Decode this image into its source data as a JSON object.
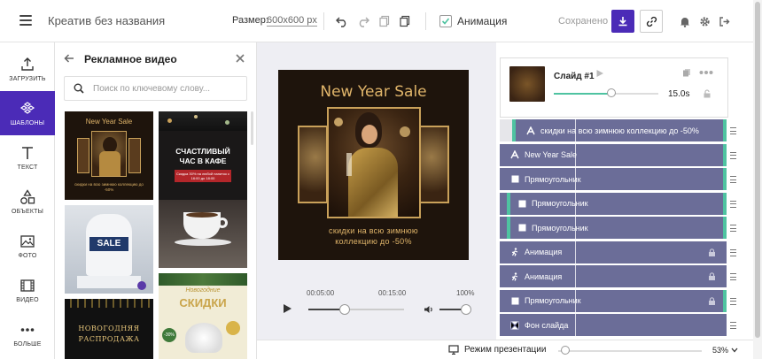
{
  "topbar": {
    "doc_title": "Креатив без названия",
    "size_label": "Размер:",
    "size_value": "600x600 px",
    "animation_label": "Анимация",
    "saved_label": "Сохранено"
  },
  "rail": {
    "items": [
      {
        "label": "ЗАГРУЗИТЬ",
        "icon": "upload-icon"
      },
      {
        "label": "ШАБЛОНЫ",
        "icon": "templates-icon"
      },
      {
        "label": "ТЕКСТ",
        "icon": "text-icon"
      },
      {
        "label": "ОБЪЕКТЫ",
        "icon": "shapes-icon"
      },
      {
        "label": "ФОТО",
        "icon": "photo-icon"
      },
      {
        "label": "ВИДЕО",
        "icon": "video-icon"
      },
      {
        "label": "БОЛЬШЕ",
        "icon": "more-icon"
      }
    ]
  },
  "panel": {
    "title": "Рекламное видео",
    "search_placeholder": "Поиск по ключевому слову...",
    "templates": {
      "t1_title": "New Year Sale",
      "t1_sub": "скидки на всю зимнюю коллекцию до -50%",
      "t2_title_1": "СЧАСТЛИВЫЙ",
      "t2_title_2": "ЧАС В КАФЕ",
      "t2_sub": "Скидка 30% на любой напиток с 16:00 до 18:00",
      "t3_title": "SALE",
      "t4_title_1": "НОВОГОДНЯЯ",
      "t4_title_2": "РАСПРОДАЖА",
      "t5_title_1": "Новогодние",
      "t5_title_2": "СКИДКИ",
      "t5_badge": "-30%"
    }
  },
  "canvas": {
    "title": "New Year Sale",
    "subtitle_1": "скидки на всю зимнюю",
    "subtitle_2": "коллекцию до -50%"
  },
  "player": {
    "time_start": "00:05:00",
    "time_end": "00:15:00",
    "volume": "100%",
    "progress": 0.38,
    "volume_level": 1.0
  },
  "slide": {
    "name": "Слайд #1",
    "duration": "15.0s",
    "duration_fraction": 0.55
  },
  "layers": [
    {
      "type": "text",
      "label": "скидки на всю зимнюю коллекцию до -50%",
      "icon": "text-layer-icon",
      "locked": false,
      "accent": "left"
    },
    {
      "type": "text",
      "label": "New Year Sale",
      "icon": "text-layer-icon",
      "locked": false,
      "accent": "right"
    },
    {
      "type": "rect",
      "label": "Прямоугольник",
      "icon": "rectangle-icon",
      "locked": false,
      "accent": "right"
    },
    {
      "type": "rect",
      "label": "Прямоугольник",
      "icon": "rectangle-icon",
      "locked": false,
      "accent": "both"
    },
    {
      "type": "rect",
      "label": "Прямоугольник",
      "icon": "rectangle-icon",
      "locked": false,
      "accent": "both"
    },
    {
      "type": "anim",
      "label": "Анимация",
      "icon": "animation-icon",
      "locked": true,
      "accent": "none"
    },
    {
      "type": "anim",
      "label": "Анимация",
      "icon": "animation-icon",
      "locked": true,
      "accent": "none"
    },
    {
      "type": "rect",
      "label": "Прямоугольник",
      "icon": "rectangle-icon",
      "locked": true,
      "accent": "right"
    },
    {
      "type": "bg",
      "label": "Фон слайда",
      "icon": "background-icon",
      "locked": false,
      "accent": "none"
    }
  ],
  "bottombar": {
    "present_label": "Режим презентации",
    "zoom": "53%",
    "zoom_level": 0.53
  },
  "colors": {
    "brand": "#4b2bb7",
    "layer_bg": "#6b6d98",
    "accent": "#4fc3a1",
    "gold": "#e0b56a"
  }
}
